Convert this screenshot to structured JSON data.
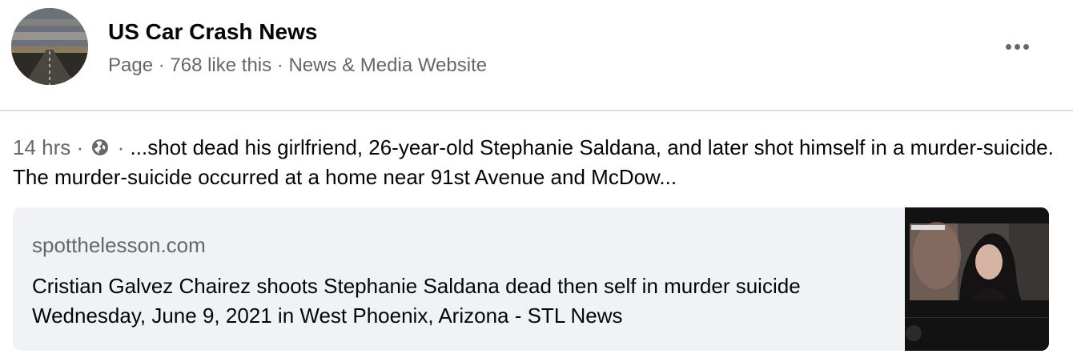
{
  "page": {
    "name": "US Car Crash News",
    "meta": "Page · 768 like this · News & Media Website"
  },
  "post": {
    "time": "14 hrs",
    "separator": "·",
    "privacy_icon": "globe-icon",
    "text": "...shot dead his girlfriend, 26-year-old Stephanie Saldana, and later shot himself in a murder-suicide. The murder-suicide occurred at a home near 91st Avenue and McDow..."
  },
  "link": {
    "domain": "spotthelesson.com",
    "title": "Cristian Galvez Chairez shoots Stephanie Saldana dead then self in murder suicide Wednesday, June 9, 2021 in West Phoenix, Arizona - STL News"
  },
  "icons": {
    "more": "more-horizontal-icon",
    "privacy": "globe-icon"
  },
  "colors": {
    "text_primary": "#050505",
    "text_secondary": "#65676b",
    "card_background": "#f0f2f5",
    "divider": "#dadde1"
  }
}
